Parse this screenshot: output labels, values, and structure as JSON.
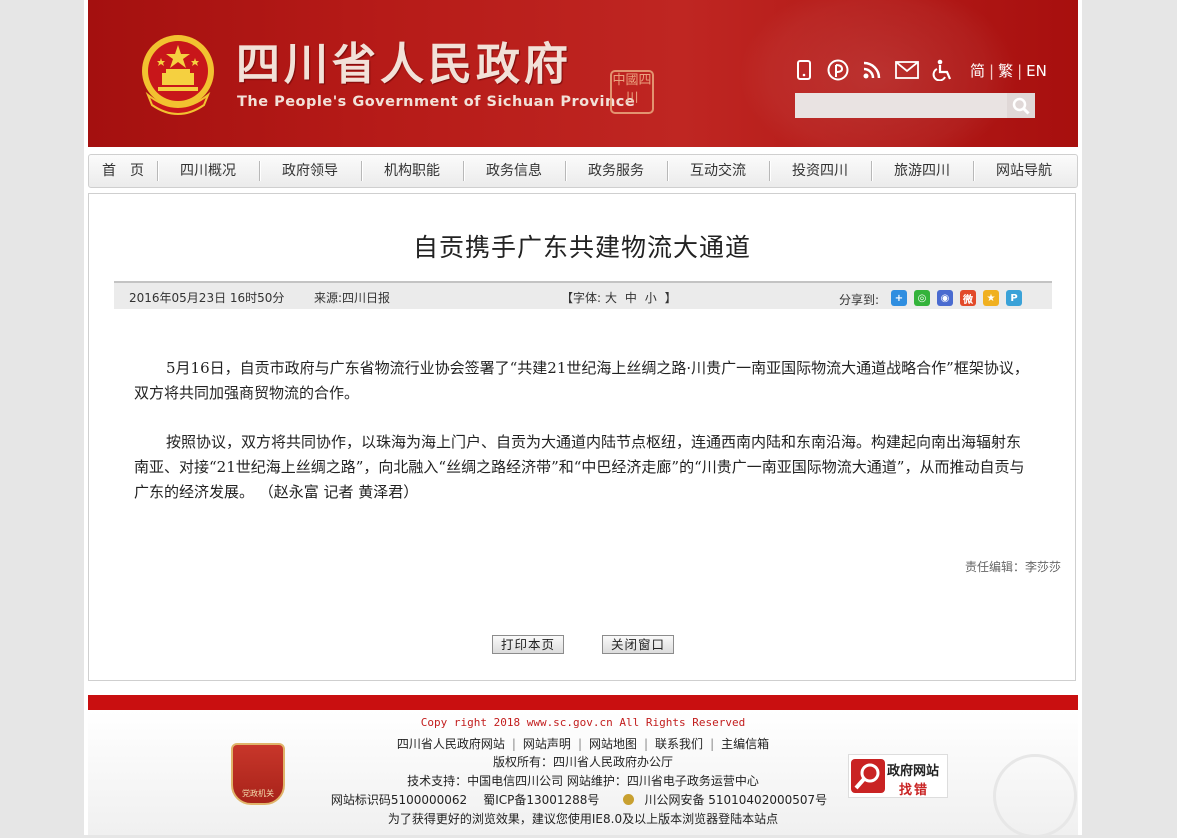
{
  "header": {
    "title": "四川省人民政府",
    "subtitle": "The People's Government of Sichuan Province",
    "seal_text": "中國四川",
    "tools": [
      {
        "icon": "mobile-icon"
      },
      {
        "icon": "weibo-icon"
      },
      {
        "icon": "rss-icon"
      },
      {
        "icon": "mail-icon"
      },
      {
        "icon": "accessibility-icon"
      }
    ],
    "languages": [
      "简",
      "繁",
      "EN"
    ],
    "search": {
      "placeholder": "",
      "value": ""
    }
  },
  "nav": {
    "items": [
      "首　页",
      "四川概况",
      "政府领导",
      "机构职能",
      "政务信息",
      "政务服务",
      "互动交流",
      "投资四川",
      "旅游四川",
      "网站导航"
    ]
  },
  "article": {
    "title": "自贡携手广东共建物流大通道",
    "date": "2016年05月23日 16时50分",
    "source": "来源:四川日报",
    "font_size": {
      "open": "【字体:",
      "large": "大",
      "medium": "中",
      "small": "小",
      "close": "】"
    },
    "share_label": "分享到:",
    "share_services": [
      {
        "name": "more-share-icon",
        "color": "#2f8ee0",
        "glyph": "+"
      },
      {
        "name": "wechat-icon",
        "color": "#34b33b",
        "glyph": "◎"
      },
      {
        "name": "qq-icon",
        "color": "#4a6bd0",
        "glyph": "◉"
      },
      {
        "name": "sina-weibo-icon",
        "color": "#e24a2a",
        "glyph": "微"
      },
      {
        "name": "qzone-icon",
        "color": "#f0b020",
        "glyph": "★"
      },
      {
        "name": "tencent-weibo-icon",
        "color": "#3aa2d8",
        "glyph": "P"
      }
    ],
    "paragraphs": [
      "5月16日，自贡市政府与广东省物流行业协会签署了“共建21世纪海上丝绸之路·川贵广一南亚国际物流大通道战略合作”框架协议，双方将共同加强商贸物流的合作。",
      "按照协议，双方将共同协作，以珠海为海上门户、自贡为大通道内陆节点枢纽，连通西南内陆和东南沿海。构建起向南出海辐射东南亚、对接“21世纪海上丝绸之路”，向北融入“丝绸之路经济带”和“中巴经济走廊”的“川贵广一南亚国际物流大通道”，从而推动自贡与广东的经济发展。 （赵永富 记者 黄泽君）"
    ],
    "editor": "责任编辑：李莎莎",
    "print_label": "打印本页",
    "close_label": "关闭窗口"
  },
  "footer": {
    "copyright": "Copy right 2018 www.sc.gov.cn All Rights Reserved",
    "links": [
      "四川省人民政府网站",
      "网站声明",
      "网站地图",
      "联系我们",
      "主编信箱"
    ],
    "owner": "版权所有：四川省人民政府办公厅",
    "support": "技术支持：中国电信四川公司  网站维护：四川省电子政务运营中心",
    "site_id": "网站标识码5100000062",
    "icp": "蜀ICP备13001288号",
    "police": "川公网安备 51010402000507号",
    "tip": "为了获得更好的浏览效果，建议您使用IE8.0及以上版本浏览器登陆本站点",
    "party_badge_text": "党政机关",
    "error_badge": {
      "line1": "政府网站",
      "line2": "找错"
    }
  }
}
